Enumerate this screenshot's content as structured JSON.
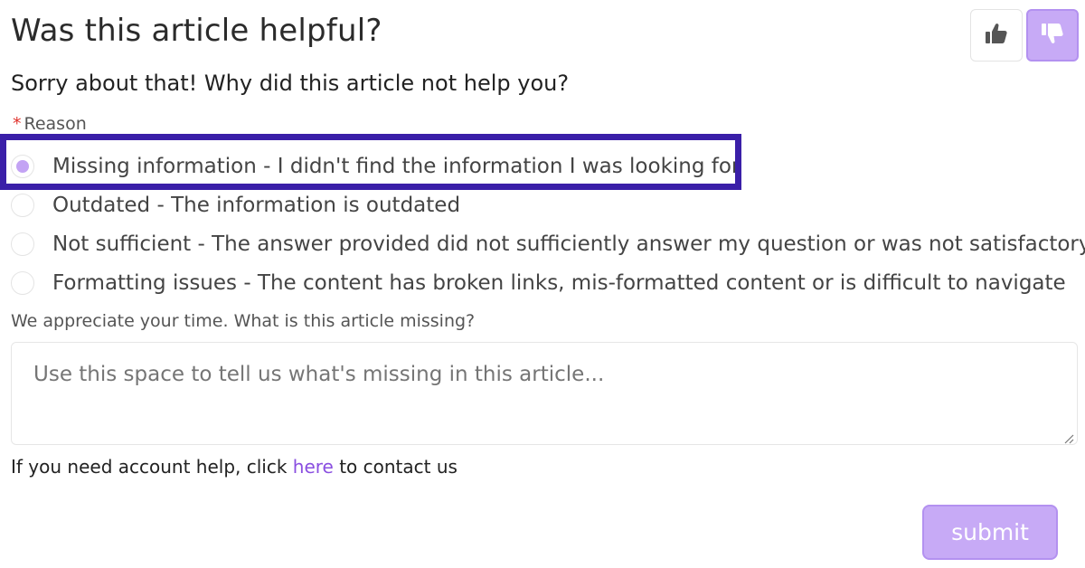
{
  "header": {
    "title": "Was this article helpful?"
  },
  "vote": {
    "up_icon": "thumbs-up-icon",
    "down_icon": "thumbs-down-icon",
    "selected": "down",
    "accent_color": "#c7aaf6"
  },
  "form": {
    "subtitle": "Sorry about that! Why did this article not help you?",
    "required_marker": "*",
    "reason_label": "Reason",
    "reasons": [
      {
        "label": "Missing information - I didn't find the information I was looking for",
        "selected": true
      },
      {
        "label": "Outdated - The information is outdated",
        "selected": false
      },
      {
        "label": "Not sufficient - The answer provided did not sufficiently answer my question or was not satisfactory",
        "selected": false
      },
      {
        "label": "Formatting issues - The content has broken links, mis-formatted content or is difficult to navigate",
        "selected": false
      }
    ],
    "textarea_label": "We appreciate your time. What is this article missing?",
    "textarea_placeholder": "Use this space to tell us what's missing in this article...",
    "textarea_value": "",
    "highlight_color": "#3a1fa8"
  },
  "help": {
    "prefix": "If you need account help, click ",
    "link_text": "here",
    "suffix": " to contact us",
    "link_color": "#8a4fe0"
  },
  "actions": {
    "submit_label": "submit"
  }
}
